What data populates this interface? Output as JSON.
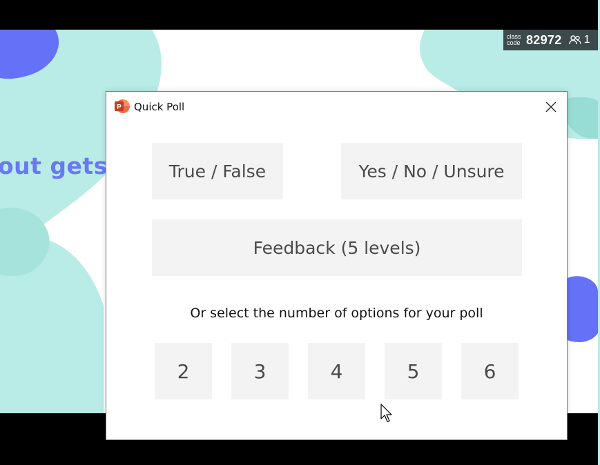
{
  "slide": {
    "visible_text": "out gets"
  },
  "badge": {
    "label_line1": "class",
    "label_line2": "code",
    "code": "82972",
    "participants": "1",
    "icon": "users-icon"
  },
  "dialog": {
    "title": "Quick Poll",
    "app_icon": "powerpoint-icon",
    "close_icon": "close-icon",
    "presets": {
      "true_false": "True / False",
      "yes_no_unsure": "Yes / No / Unsure",
      "feedback": "Feedback (5 levels)"
    },
    "hint": "Or select the number of options for your poll",
    "numbers": [
      "2",
      "3",
      "4",
      "5",
      "6"
    ]
  },
  "colors": {
    "accent_text": "#6a78f5",
    "teal_blob": "#b9ece6",
    "blue_blob": "#6571f7",
    "button_bg": "#f3f3f3",
    "badge_bg": "#3c4a4b",
    "ppt_orange": "#c43e1c"
  }
}
